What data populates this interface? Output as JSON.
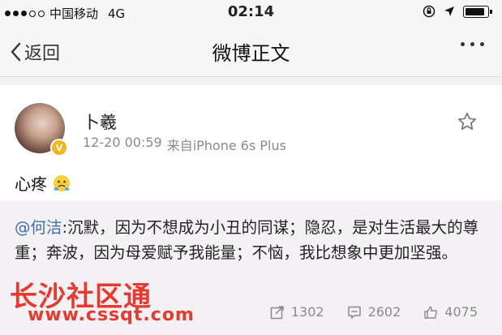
{
  "status_bar": {
    "carrier": "中国移动",
    "network": "4G",
    "time": "02:14"
  },
  "nav": {
    "back_label": "返回",
    "title": "微博正文"
  },
  "post": {
    "username": "卜羲",
    "timestamp": "12-20 00:59",
    "source": "来自iPhone 6s Plus",
    "text": "心疼",
    "emoji": "emoji-face-icon",
    "repost": {
      "mention": "@何洁",
      "body": ":沉默，因为不想成为小丑的同谋；隐忍，是对生活最大的尊重；奔波，因为母爱赋予我能量；不恼，我比想象中更加坚强。",
      "reposts": "1302",
      "comments": "2602",
      "likes": "4075"
    }
  },
  "watermark": {
    "line1": "长沙社区通",
    "line2": "www.cssqt.com"
  },
  "colors": {
    "mention": "#3c6ea8",
    "watermark": "#e8392f",
    "verified": "#f4b51e"
  }
}
